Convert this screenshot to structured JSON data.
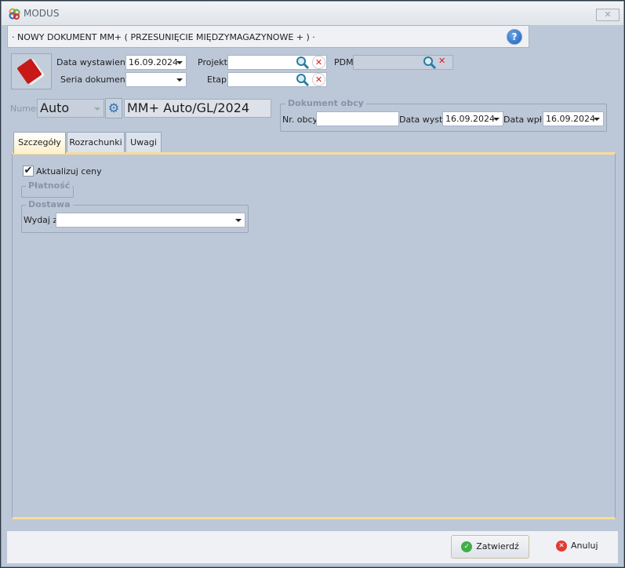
{
  "window": {
    "title": "MODUS",
    "close_icon": "close-icon"
  },
  "header": {
    "title": "· NOWY DOKUMENT MM+ ( PRZESUNIĘCIE MIĘDZYMAGAZYNOWE + ) ·",
    "help": "?"
  },
  "form": {
    "data_wystawienia_label": "Data wystawienia",
    "data_wystawienia": "16.09.2024",
    "seria_label": "Seria dokumentu",
    "seria": "",
    "projekt_label": "Projekt",
    "projekt": "",
    "etap_label": "Etap",
    "etap": "",
    "pdm_label": "PDM",
    "pdm": "",
    "numer_label": "Numer",
    "numer_mode": "Auto",
    "numer_value": "MM+ Auto/GL/2024"
  },
  "dokument_obcy": {
    "title": "Dokument obcy",
    "nr_label": "Nr. obcy",
    "nr": "",
    "data_wyst_label": "Data wyst.",
    "data_wyst": "16.09.2024",
    "data_wpl_label": "Data wpł.",
    "data_wpl": "16.09.2024"
  },
  "tabs": [
    {
      "label": "Szczegóły",
      "active": true
    },
    {
      "label": "Rozrachunki"
    },
    {
      "label": "Uwagi"
    }
  ],
  "details": {
    "aktualizuj_label": "Aktualizuj ceny",
    "aktualizuj_checked": true,
    "platnosc_title": "Płatność",
    "dostawa_title": "Dostawa",
    "wydaj_label": "Wydaj z",
    "wydaj": ""
  },
  "footer": {
    "ok": "Zatwierdź",
    "cancel": "Anuluj"
  },
  "colors": {
    "background": "#bcc8d8",
    "tab_accent": "#f8dc98",
    "ok": "#3fae49",
    "cancel": "#e53a2f"
  }
}
